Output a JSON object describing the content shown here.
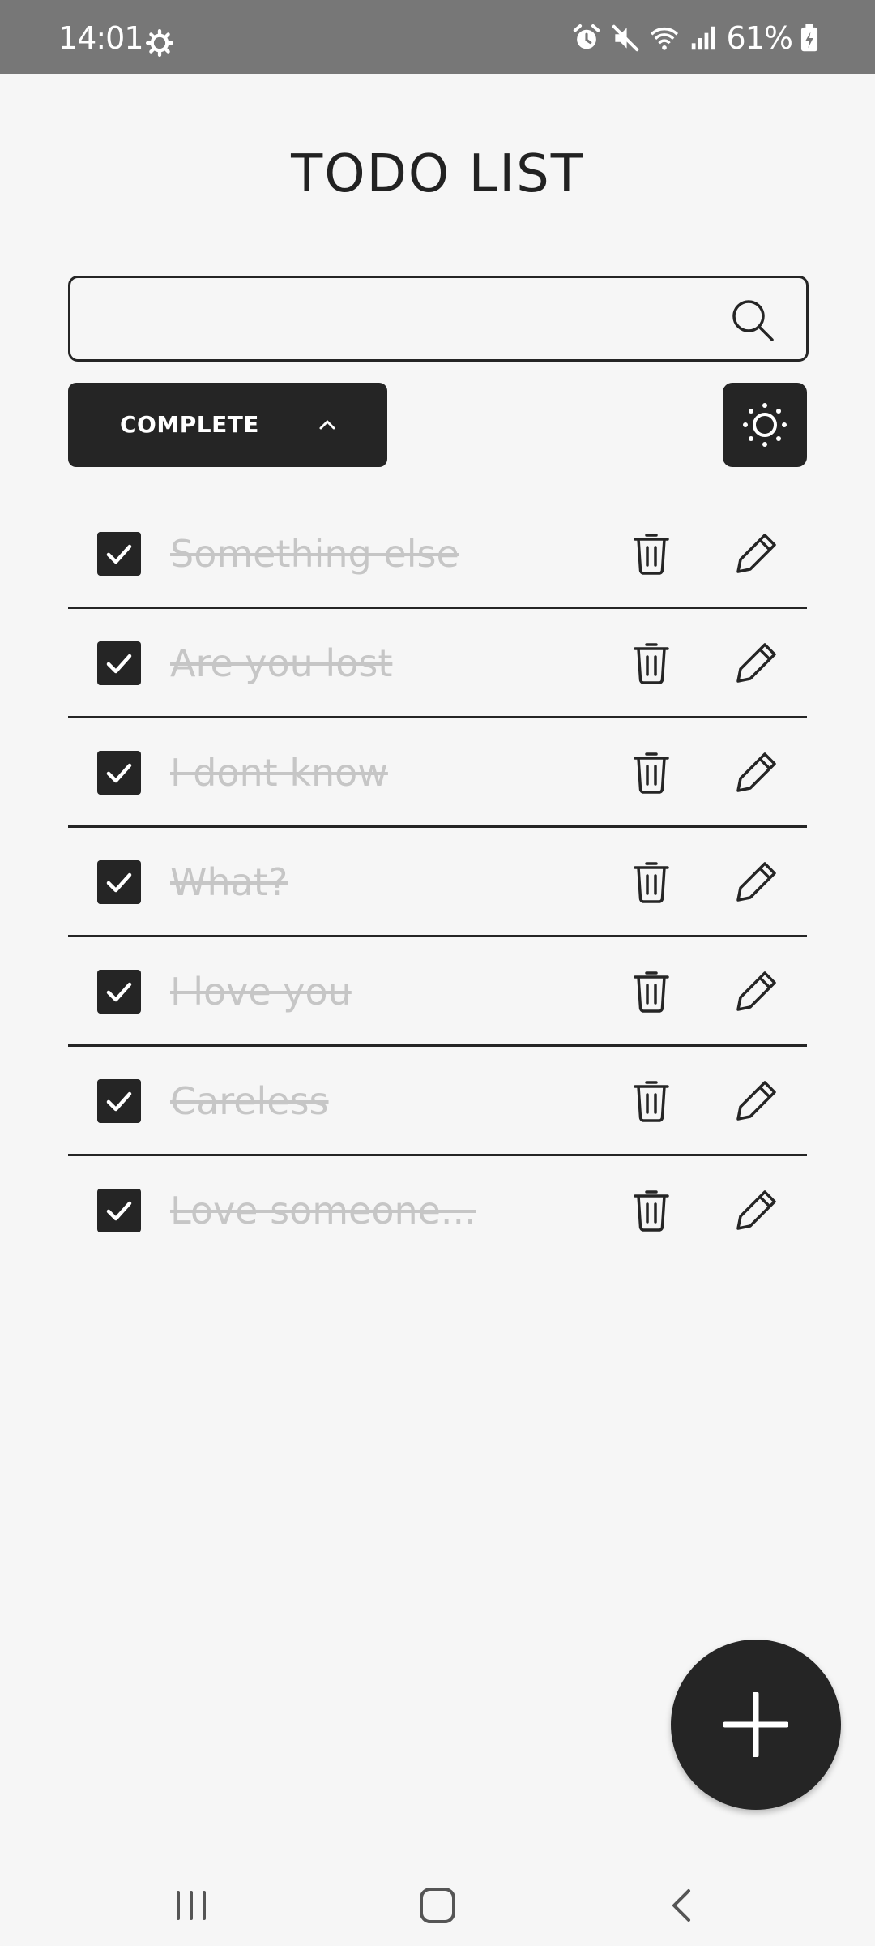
{
  "status_bar": {
    "time": "14:01",
    "battery": "61%",
    "icons": [
      "gear-icon",
      "alarm-icon",
      "mute-icon",
      "wifi-icon",
      "signal-icon",
      "battery-charging-icon"
    ],
    "background": "#777777"
  },
  "header": {
    "title": "TODO LIST"
  },
  "search": {
    "value": "",
    "placeholder": "",
    "icon": "search-icon"
  },
  "filter": {
    "label": "COMPLETE",
    "icon": "chevron-up-icon"
  },
  "theme_toggle": {
    "icon": "sun-icon"
  },
  "todos": [
    {
      "text": "Something else",
      "checked": true
    },
    {
      "text": "Are you lost",
      "checked": true
    },
    {
      "text": "I dont know",
      "checked": true
    },
    {
      "text": "What?",
      "checked": true
    },
    {
      "text": "I love you",
      "checked": true
    },
    {
      "text": "Careless",
      "checked": true
    },
    {
      "text": "Love someone...",
      "checked": true
    }
  ],
  "fab": {
    "icon": "plus-icon"
  },
  "nav_bar": {
    "icons": [
      "recent-apps-icon",
      "home-icon",
      "back-icon"
    ]
  },
  "colors": {
    "dark": "#252525",
    "background": "#f6f6f6",
    "completed_text": "#c6c6c6"
  }
}
